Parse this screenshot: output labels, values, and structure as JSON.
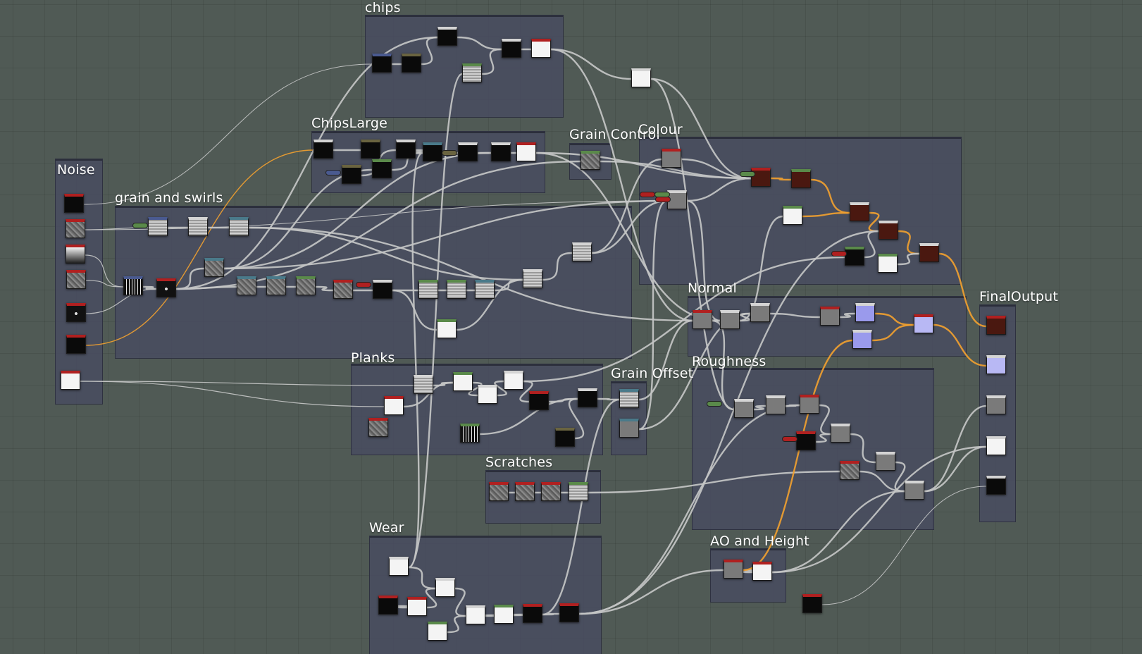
{
  "frames": [
    {
      "id": "chips",
      "label": "chips"
    },
    {
      "id": "chipslarge",
      "label": "ChipsLarge"
    },
    {
      "id": "noise",
      "label": "Noise"
    },
    {
      "id": "grain",
      "label": "grain and swirls"
    },
    {
      "id": "graincontrol",
      "label": "Grain Control"
    },
    {
      "id": "colour",
      "label": "Colour"
    },
    {
      "id": "normal",
      "label": "Normal"
    },
    {
      "id": "roughness",
      "label": "Roughness"
    },
    {
      "id": "finaloutput",
      "label": "FinalOutput"
    },
    {
      "id": "planks",
      "label": "Planks"
    },
    {
      "id": "grainoffset",
      "label": "Grain Offset"
    },
    {
      "id": "scratches",
      "label": "Scratches"
    },
    {
      "id": "wear",
      "label": "Wear"
    },
    {
      "id": "aoheight",
      "label": "AO and Height"
    }
  ],
  "colors": {
    "background": "#505a55",
    "frame": "#484c60",
    "wire": "#c4c6c6",
    "wire_highlight": "#f0a030",
    "header_red": "#b02020",
    "header_white": "#d4d4d4",
    "header_green": "#5a8a4a",
    "header_teal": "#4a7a8a",
    "header_olive": "#6a6440",
    "header_blue": "#4a5a90",
    "swatch_white": "#f4f4f4",
    "swatch_black": "#0a0a0a",
    "swatch_gray": "#7a7a7a",
    "swatch_lightgray": "#bdbdbd",
    "swatch_brown": "#4a1810",
    "swatch_lavender": "#b8b8f4",
    "swatch_violet": "#9a9aec"
  },
  "icons": [
    "graph-node",
    "input-pin",
    "connection-wire"
  ]
}
